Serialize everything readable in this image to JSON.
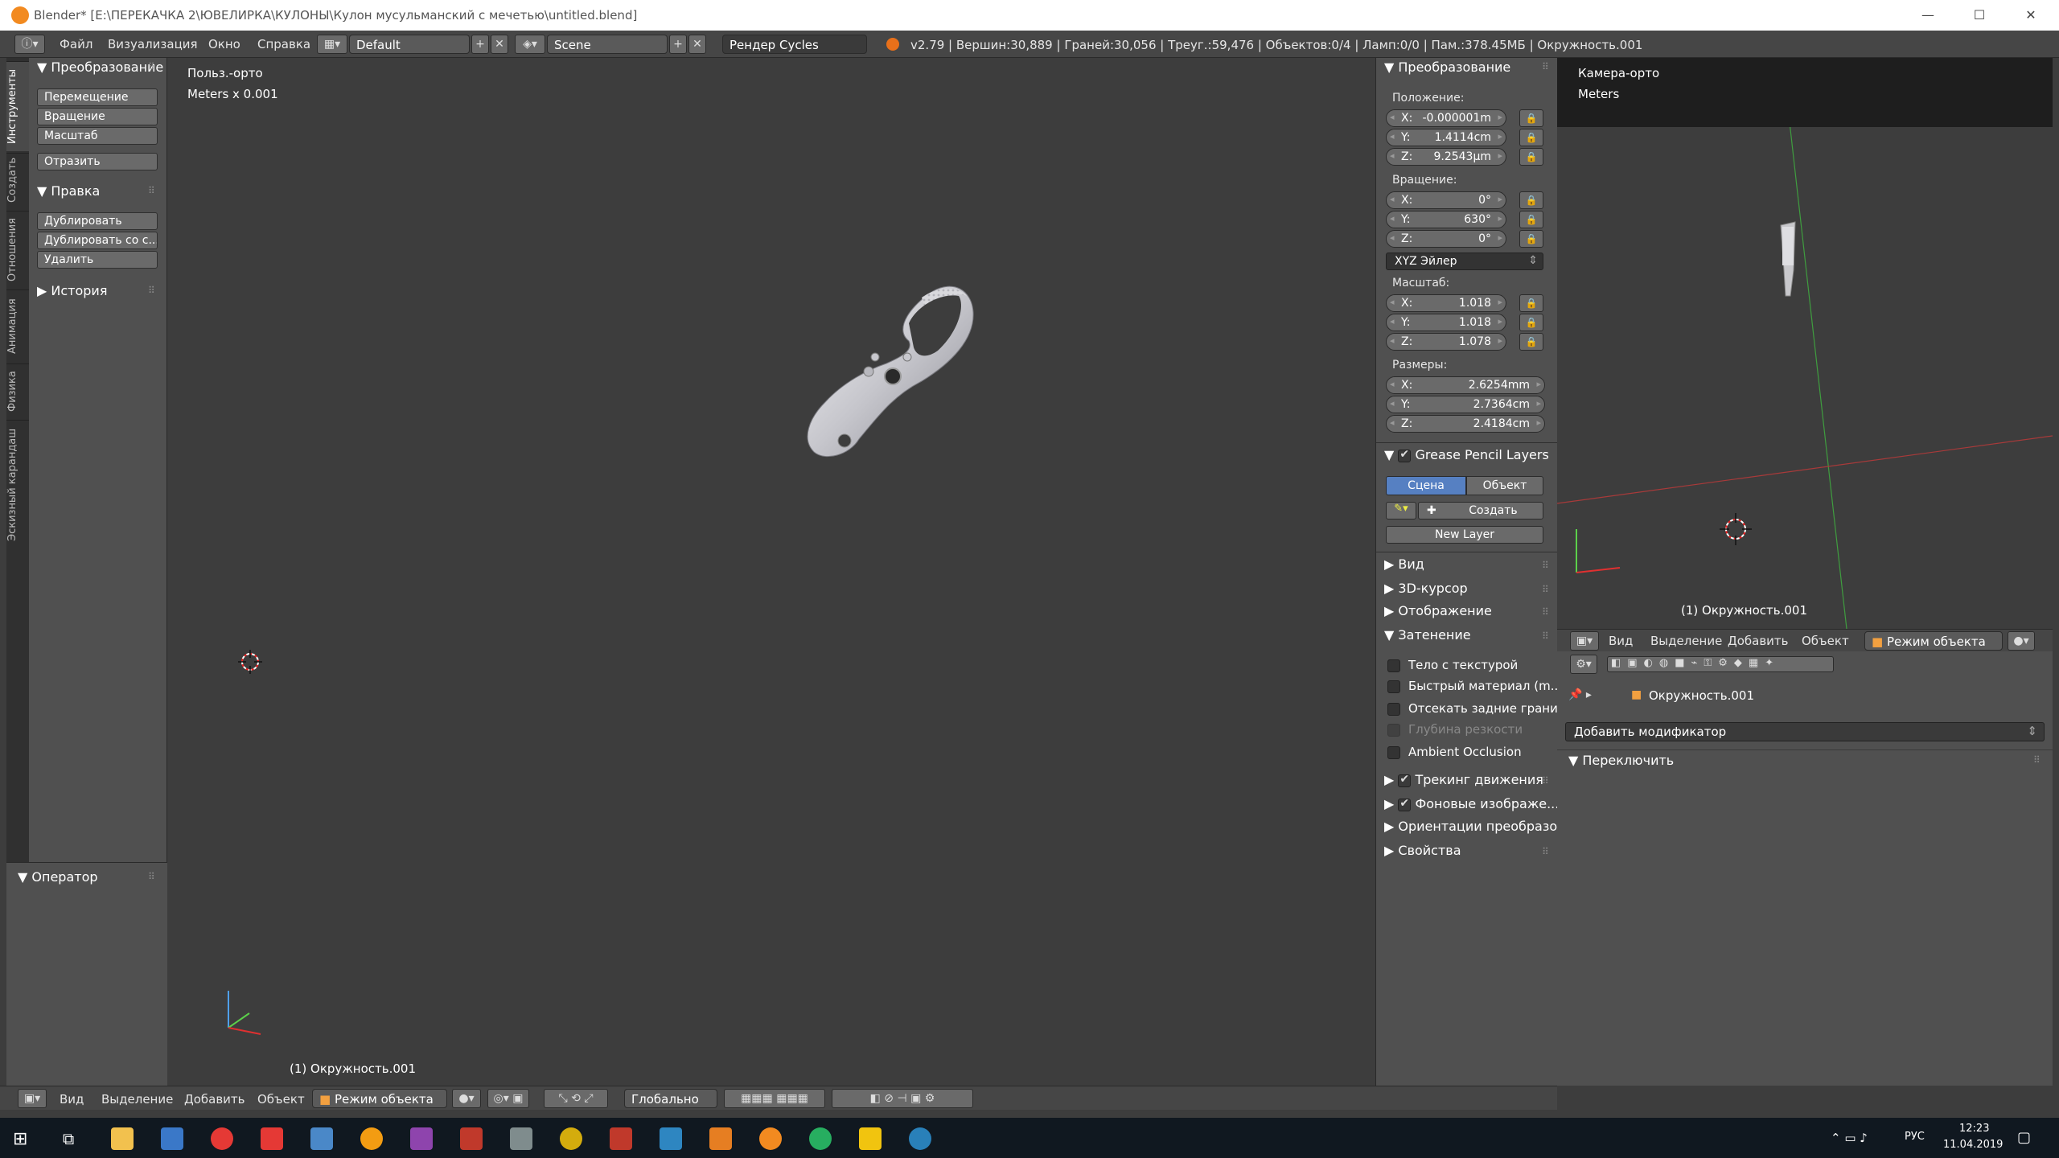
{
  "window": {
    "title": "Blender* [E:\\ПЕРЕКАЧКА 2\\ЮВЕЛИРКА\\КУЛОНЫ\\Кулон мусульманский с мечетью\\untitled.blend]",
    "minimize": "—",
    "maximize": "☐",
    "close": "✕"
  },
  "topbar": {
    "menu": [
      "Файл",
      "Визуализация",
      "Окно",
      "Справка"
    ],
    "layout": "Default",
    "scene": "Scene",
    "engine": "Рендер Cycles",
    "stats": "v2.79 | Вершин:30,889 | Граней:30,056 | Треуг.:59,476 | Объектов:0/4 | Ламп:0/0 | Пам.:378.45МБ | Окружность.001"
  },
  "tabs": [
    "Инструменты",
    "Создать",
    "Отношения",
    "Анимация",
    "Физика",
    "Эскизный карандаш"
  ],
  "toolshelf": {
    "transform_header": "Преобразование",
    "transform_buttons": [
      "Перемещение",
      "Вращение",
      "Масштаб"
    ],
    "mirror": "Отразить",
    "edit_header": "Правка",
    "edit_buttons": [
      "Дублировать",
      "Дублировать со с...",
      "Удалить"
    ],
    "history_header": "История",
    "operator_header": "Оператор"
  },
  "viewport": {
    "view_name": "Польз.-орто",
    "units": "Meters x 0.001",
    "object_name": "(1) Окружность.001"
  },
  "npanel": {
    "header": "Преобразование",
    "location_label": "Положение:",
    "location": [
      {
        "axis": "X:",
        "value": "-0.000001m"
      },
      {
        "axis": "Y:",
        "value": "1.4114cm"
      },
      {
        "axis": "Z:",
        "value": "9.2543μm"
      }
    ],
    "rotation_label": "Вращение:",
    "rotation": [
      {
        "axis": "X:",
        "value": "0°"
      },
      {
        "axis": "Y:",
        "value": "630°"
      },
      {
        "axis": "Z:",
        "value": "0°"
      }
    ],
    "rotation_mode": "XYZ Эйлер",
    "scale_label": "Масштаб:",
    "scale": [
      {
        "axis": "X:",
        "value": "1.018"
      },
      {
        "axis": "Y:",
        "value": "1.018"
      },
      {
        "axis": "Z:",
        "value": "1.078"
      }
    ],
    "dims_label": "Размеры:",
    "dims": [
      {
        "axis": "X:",
        "value": "2.6254mm"
      },
      {
        "axis": "Y:",
        "value": "2.7364cm"
      },
      {
        "axis": "Z:",
        "value": "2.4184cm"
      }
    ],
    "gp_header": "Grease Pencil Layers",
    "gp_scene": "Сцена",
    "gp_object": "Объект",
    "gp_new": "Создать",
    "gp_newlayer": "New Layer",
    "sections": [
      "Вид",
      "3D-курсор",
      "Отображение"
    ],
    "shading_header": "Затенение",
    "shading": [
      {
        "label": "Тело с текстурой",
        "enabled": true
      },
      {
        "label": "Быстрый материал (m...",
        "enabled": true
      },
      {
        "label": "Отсекать задние грани",
        "enabled": true
      },
      {
        "label": "Глубина резкости",
        "enabled": false
      },
      {
        "label": "Ambient Occlusion",
        "enabled": true
      }
    ],
    "motion_tracking": "Трекинг движения",
    "background_images": "Фоновые изображе...",
    "orientations": "Ориентации преобразо...",
    "properties": "Свойства"
  },
  "camview": {
    "view_name": "Камера-орто",
    "units": "Meters",
    "object_name": "(1) Окружность.001"
  },
  "props_header": {
    "menu": [
      "Вид",
      "Выделение",
      "Добавить",
      "Объект"
    ],
    "mode": "Режим объекта"
  },
  "props": {
    "object": "Окружность.001",
    "add_modifier": "Добавить модификатор",
    "toggle_section": "Переключить"
  },
  "bottombar": {
    "menu": [
      "Вид",
      "Выделение",
      "Добавить",
      "Объект"
    ],
    "mode": "Режим объекта",
    "orientation": "Глобально"
  },
  "taskbar": {
    "lang": "РУС",
    "time": "12:23",
    "date": "11.04.2019"
  },
  "colors": {
    "accent": "#5680c2",
    "viewport_bg": "#3d3d3d",
    "panel_bg": "#505050"
  }
}
